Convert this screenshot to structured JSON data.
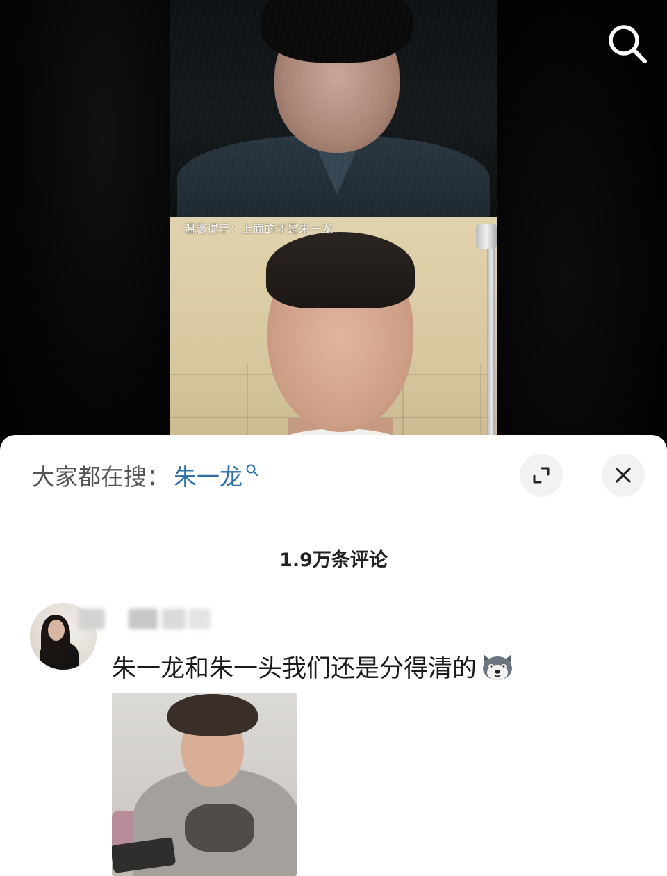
{
  "video": {
    "tip_text": "温馨提示：上面的才是朱一龙"
  },
  "top_bar": {
    "search_icon": "search-icon"
  },
  "sheet": {
    "hot_search": {
      "prefix": "大家都在搜：",
      "term": "朱一龙",
      "icon": "search-icon"
    },
    "buttons": {
      "expand_icon": "expand-icon",
      "close_icon": "close-icon"
    },
    "comment_count": "1.9万条评论",
    "comments": [
      {
        "text": "朱一龙和朱一头我们还是分得清的",
        "emoji": "husky-dog-emoji"
      }
    ]
  }
}
